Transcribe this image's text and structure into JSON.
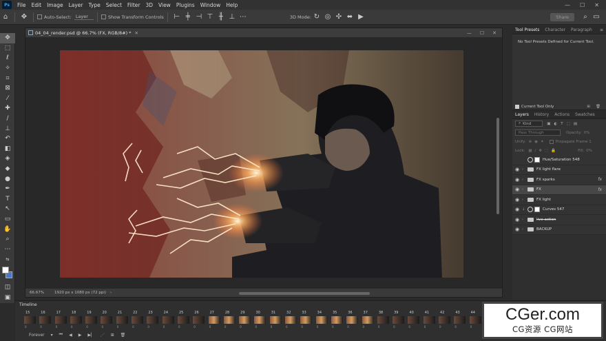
{
  "menubar": {
    "logo": "Ps",
    "items": [
      "File",
      "Edit",
      "Image",
      "Layer",
      "Type",
      "Select",
      "Filter",
      "3D",
      "View",
      "Plugins",
      "Window",
      "Help"
    ]
  },
  "options": {
    "auto_select_label": "Auto-Select:",
    "auto_select_value": "Layer",
    "show_transform_label": "Show Transform Controls",
    "mode_3d_label": "3D Mode:",
    "share_label": "Share"
  },
  "document": {
    "tab_title": "04_04_render.psd @ 66.7% (FX, RGB/8#) *",
    "zoom": "66.67%",
    "doc_size": "1920 px x 1080 px (72 ppi)"
  },
  "right_panel": {
    "tabs": [
      "Tool Presets",
      "Character",
      "Paragraph"
    ],
    "no_presets_text": "No Tool Presets Defined for Current Tool.",
    "current_tool_only": "Current Tool Only",
    "layer_tabs": [
      "Layers",
      "History",
      "Actions",
      "Swatches"
    ],
    "kind_label": "Kind",
    "blend_mode": "Pass Through",
    "opacity_label": "Opacity:",
    "opacity_value": "0%",
    "unify_label": "Unify:",
    "propagate_label": "Propagate Frame 1",
    "lock_label": "Lock:",
    "fill_label": "Fill:",
    "fill_value": "0%",
    "layers": [
      {
        "name": "Hue/Saturation 548",
        "type": "adjustment",
        "visible": false,
        "fx": ""
      },
      {
        "name": "FX light flare",
        "type": "group",
        "visible": true,
        "fx": ""
      },
      {
        "name": "FX sparks",
        "type": "group",
        "visible": true,
        "fx": "fx"
      },
      {
        "name": "FX",
        "type": "group",
        "visible": true,
        "fx": "fx",
        "selected": true
      },
      {
        "name": "FX light",
        "type": "group",
        "visible": true,
        "fx": ""
      },
      {
        "name": "Curves 547",
        "type": "adjustment",
        "visible": true,
        "fx": ""
      },
      {
        "name": "live action",
        "type": "group",
        "visible": true,
        "fx": "",
        "strike": true
      },
      {
        "name": "BACKUP",
        "type": "group",
        "visible": true,
        "fx": ""
      }
    ]
  },
  "timeline": {
    "title": "Timeline",
    "frames": [
      "15",
      "16",
      "17",
      "18",
      "19",
      "20",
      "21",
      "22",
      "23",
      "24",
      "25",
      "26",
      "27",
      "28",
      "29",
      "30",
      "31",
      "32",
      "33",
      "34",
      "35",
      "36",
      "37",
      "38",
      "39",
      "40",
      "41",
      "42",
      "43",
      "44"
    ],
    "frame_time": "0",
    "loop_label": "Forever"
  },
  "watermark": {
    "main": "CGer.com",
    "sub": "CG资源 CG网站"
  }
}
